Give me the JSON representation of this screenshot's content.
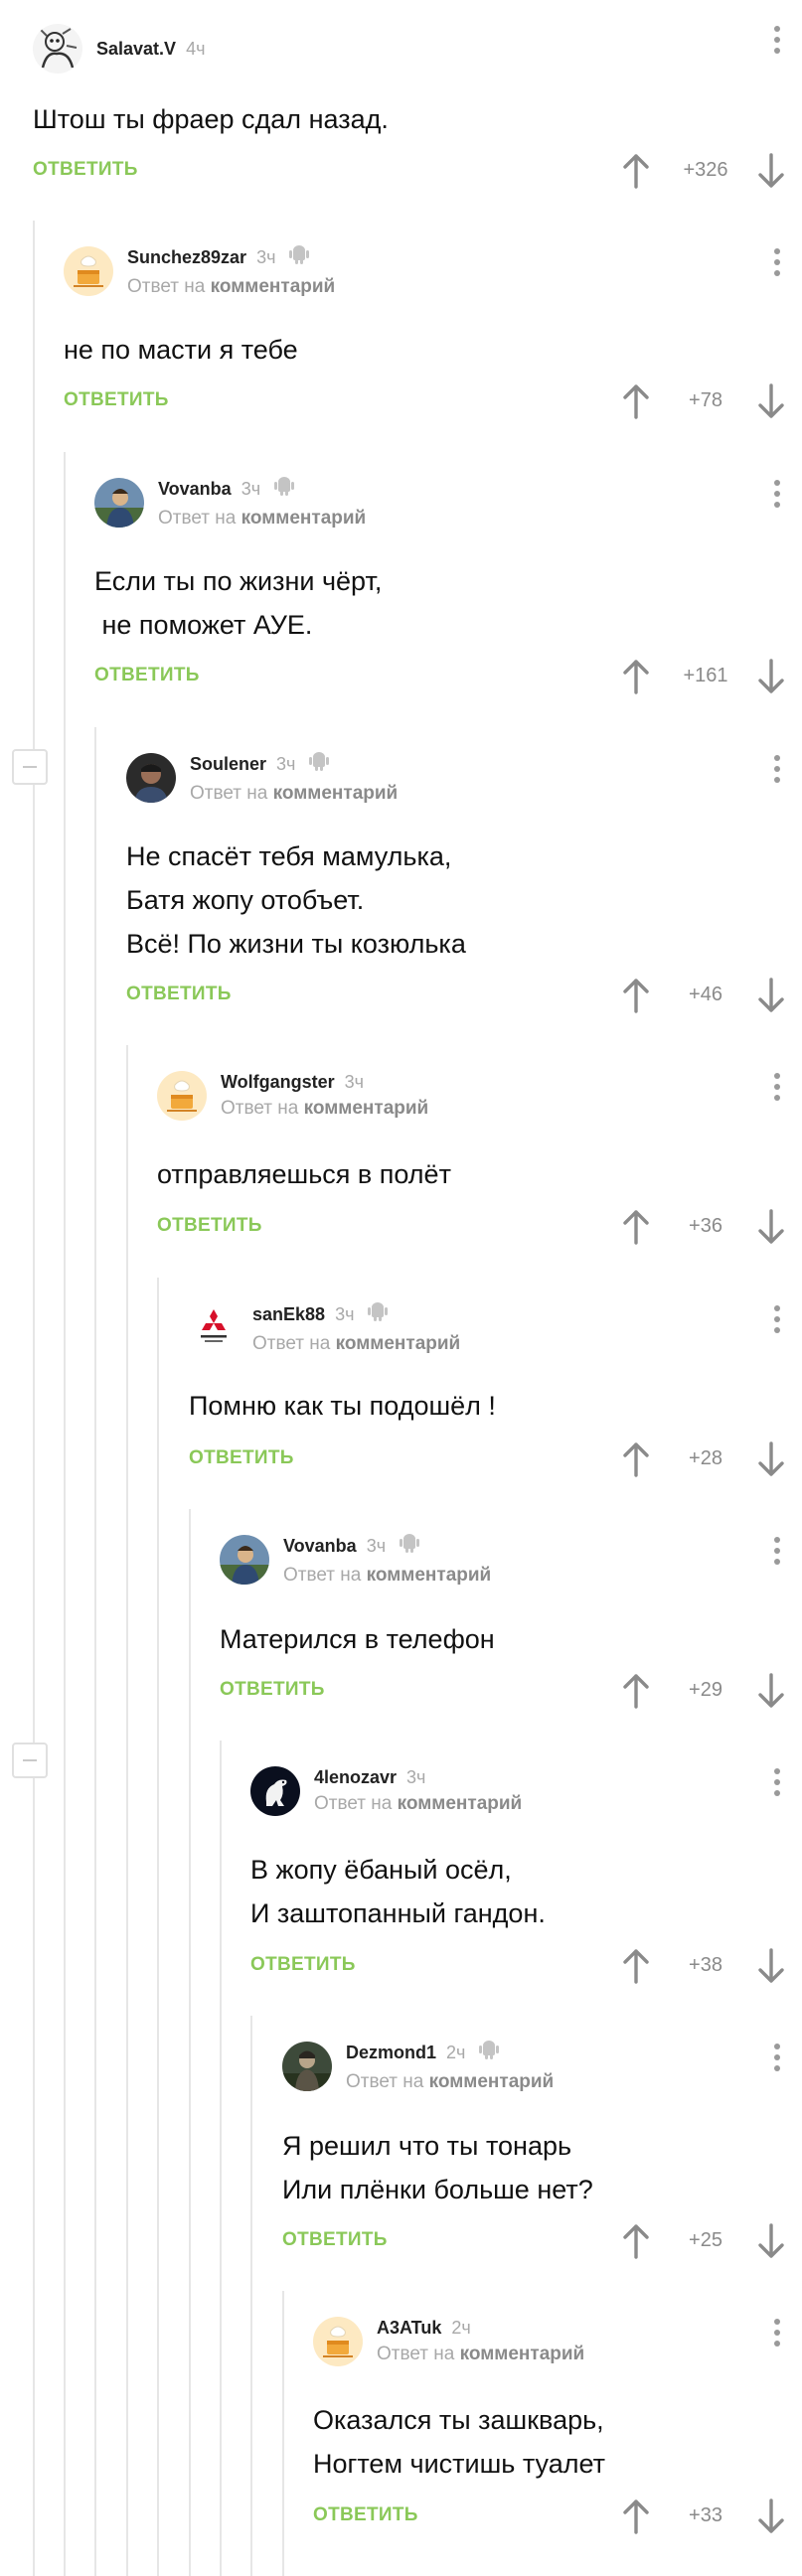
{
  "comments": [
    {
      "author": "Salavat.V",
      "time": "4ч",
      "reply_to": false,
      "android": false,
      "text": "Штош ты фраер сдал назад.",
      "reply_label": "ОТВЕТИТЬ",
      "rating": "+326",
      "avatar": "sketch-avatar"
    },
    {
      "author": "Sunchez89zar",
      "time": "3ч",
      "reply_to": true,
      "android": true,
      "text": "не по масти я тебе",
      "reply_label": "ОТВЕТИТЬ",
      "rating": "+78",
      "avatar": "default-cake-avatar"
    },
    {
      "author": "Vovanba",
      "time": "3ч",
      "reply_to": true,
      "android": true,
      "text": "Если ты по жизни чёрт,\n не поможет АУЕ.",
      "reply_label": "ОТВЕТИТЬ",
      "rating": "+161",
      "avatar": "painting-avatar"
    },
    {
      "author": "Soulener",
      "time": "3ч",
      "reply_to": true,
      "android": true,
      "text": "Не спасёт тебя мамулька,\nБатя жопу отобъет.\nВсё! По жизни ты козюлька",
      "reply_label": "ОТВЕТИТЬ",
      "rating": "+46",
      "avatar": "photo-avatar"
    },
    {
      "author": "Wolfgangster",
      "time": "3ч",
      "reply_to": true,
      "android": false,
      "text": "отправляешься в полёт",
      "reply_label": "ОТВЕТИТЬ",
      "rating": "+36",
      "avatar": "default-cake-avatar"
    },
    {
      "author": "sanEk88",
      "time": "3ч",
      "reply_to": true,
      "android": true,
      "text": "Помню как ты подошёл !",
      "reply_label": "ОТВЕТИТЬ",
      "rating": "+28",
      "avatar": "mitsubishi-logo-avatar"
    },
    {
      "author": "Vovanba",
      "time": "3ч",
      "reply_to": true,
      "android": true,
      "text": "Матерился в телефон",
      "reply_label": "ОТВЕТИТЬ",
      "rating": "+29",
      "avatar": "painting-avatar"
    },
    {
      "author": "4lenozavr",
      "time": "3ч",
      "reply_to": true,
      "android": false,
      "text": "В жопу ёбаный осёл,\nИ заштопанный гандон.",
      "reply_label": "ОТВЕТИТЬ",
      "rating": "+38",
      "avatar": "dinosaur-avatar"
    },
    {
      "author": "Dezmond1",
      "time": "2ч",
      "reply_to": true,
      "android": true,
      "text": "Я решил что ты тонарь\nИли плёнки больше нет?",
      "reply_label": "ОТВЕТИТЬ",
      "rating": "+25",
      "avatar": "game-character-avatar"
    },
    {
      "author": "A3ATuk",
      "time": "2ч",
      "reply_to": true,
      "android": false,
      "text": "Оказался ты зашкварь,\nНогтем чистишь туалет",
      "reply_label": "ОТВЕТИТЬ",
      "rating": "+33",
      "avatar": "default-cake-avatar"
    }
  ],
  "reply_prefix": "Ответ на",
  "reply_target": "комментарий",
  "colors": {
    "accent_green": "#8ac858",
    "muted_text": "#a8a8a8",
    "thread_line": "#e6e6e6"
  },
  "icons": [
    "android-icon",
    "arrow-up-icon",
    "arrow-down-icon",
    "more-vertical-icon",
    "collapse-icon"
  ]
}
